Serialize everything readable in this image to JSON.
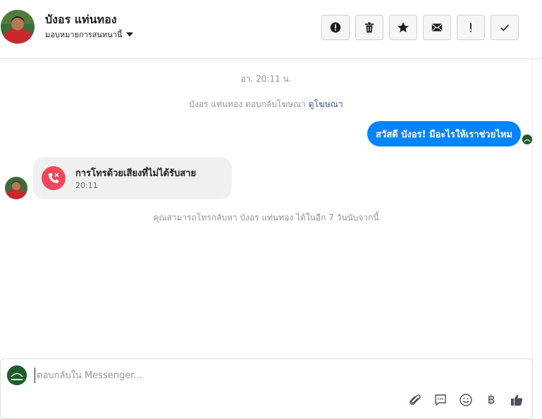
{
  "header": {
    "contact_name": "บังอร แท่นทอง",
    "assign_label": "มอบหมายการสนทนานี้",
    "actions": [
      {
        "name": "spam-button",
        "icon": "alert-circle-icon"
      },
      {
        "name": "delete-button",
        "icon": "trash-icon"
      },
      {
        "name": "star-button",
        "icon": "star-icon"
      },
      {
        "name": "mark-unread-button",
        "icon": "envelope-icon"
      },
      {
        "name": "follow-up-button",
        "icon": "exclamation-icon"
      },
      {
        "name": "mark-done-button",
        "icon": "check-icon"
      }
    ]
  },
  "conversation": {
    "timestamp": "อา. 20:11 น.",
    "ad_reply_text": "บังอร แท่นทอง ตอบกลับโฆษณา",
    "ad_link": "ดูโฆษณา",
    "outgoing_message": "สวัสดี บังอร! มีอะไรให้เราช่วยไหม",
    "missed_call": {
      "title": "การโทรด้วยเสียงที่ไม่ได้รับสาย",
      "time": "20:11"
    },
    "callback_notice": "คุณสามารถโทรกลับหา บังอร แท่นทอง ได้ในอีก 7 วันนับจากนี้"
  },
  "composer": {
    "placeholder": "ตอบกลับใน Messenger...",
    "value": "",
    "baht_symbol": "฿",
    "tools": [
      "paperclip-icon",
      "saved-reply-icon",
      "emoji-icon",
      "baht-icon",
      "thumbs-up-icon"
    ]
  },
  "colors": {
    "accent": "#0084ff",
    "missed_call": "#f0475a",
    "link": "#385898",
    "meta_text": "#90949c"
  }
}
